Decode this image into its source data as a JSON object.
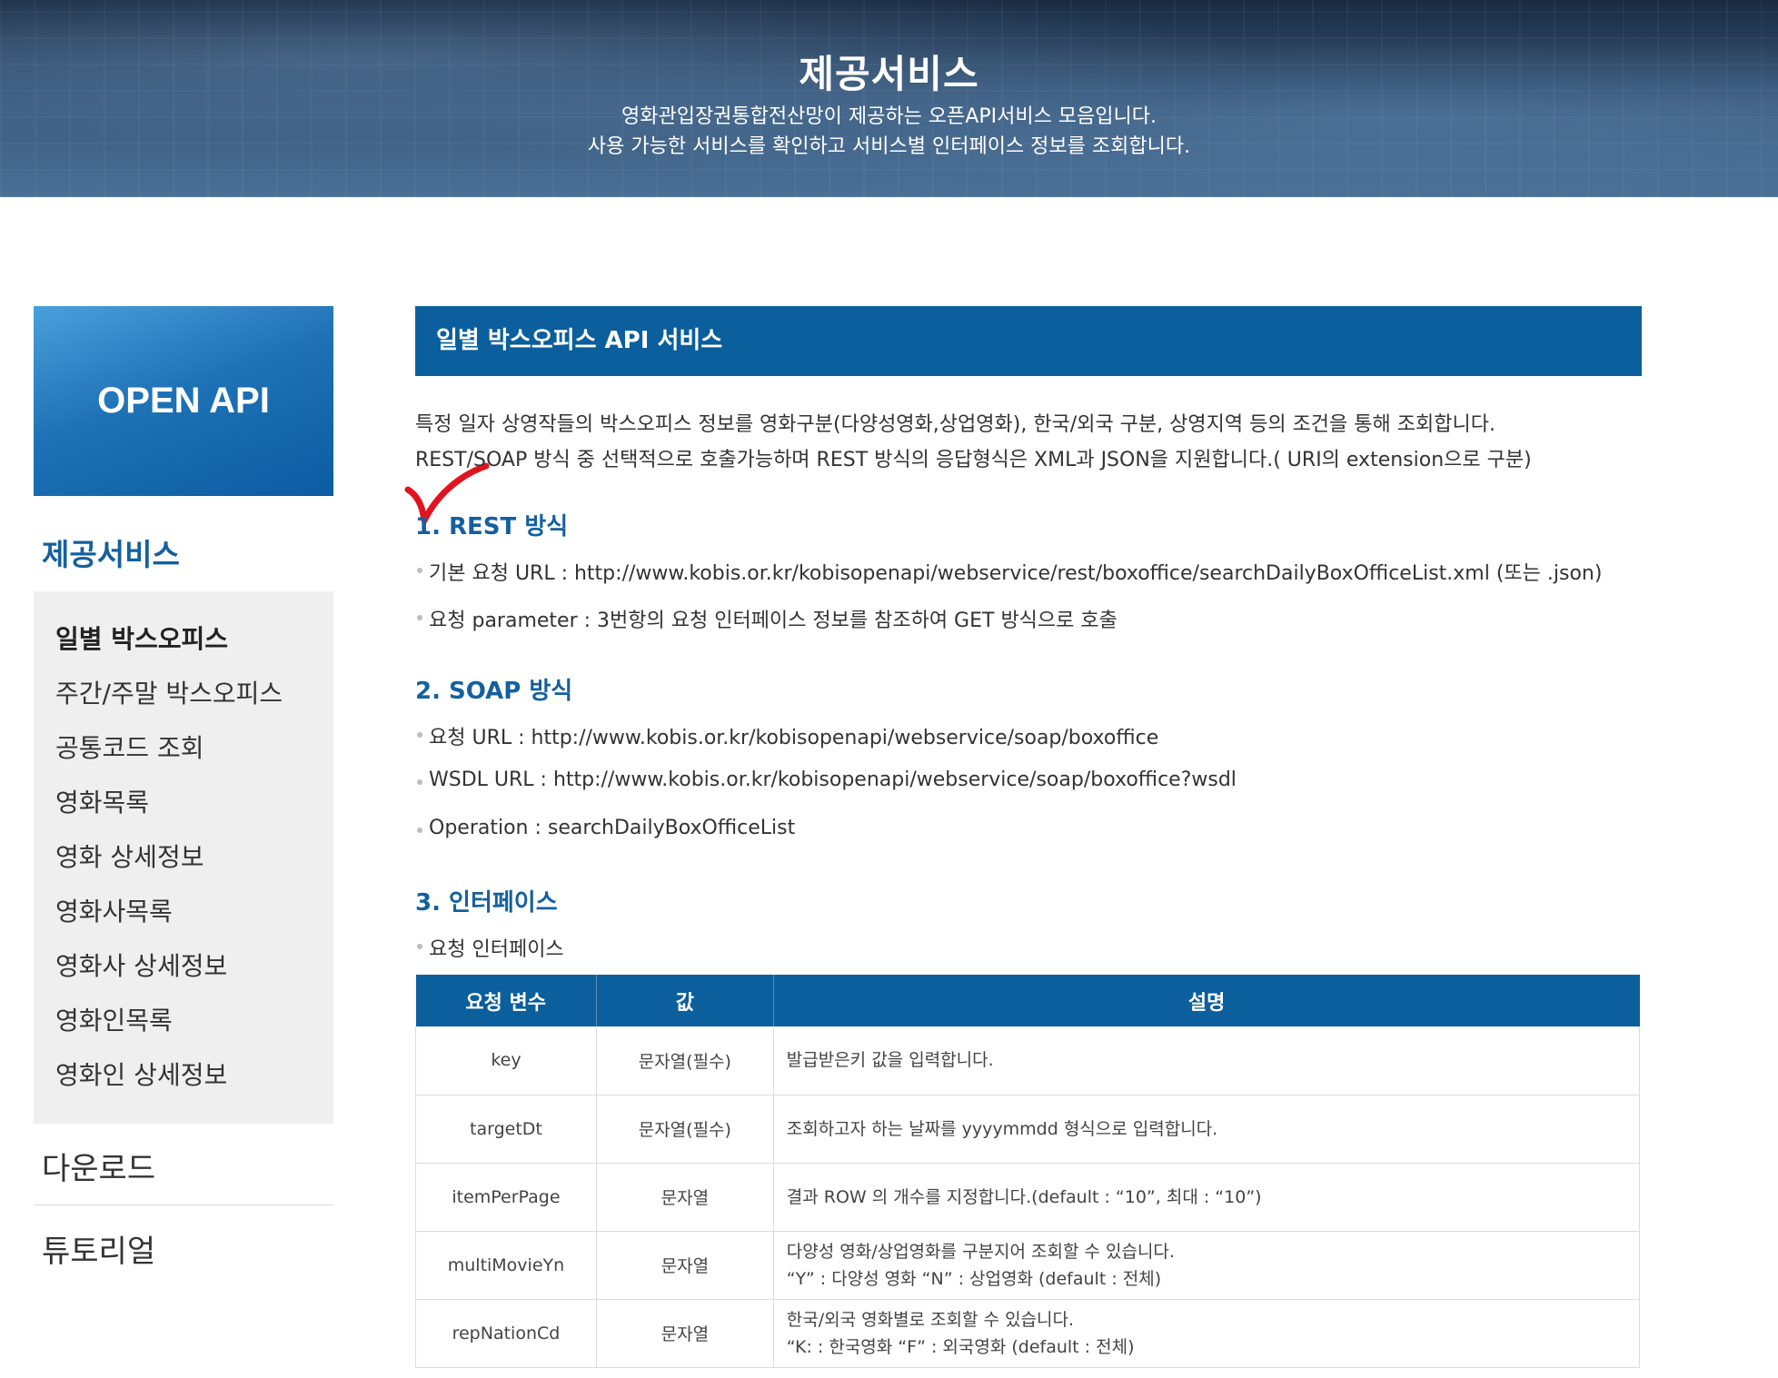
{
  "banner": {
    "title": "제공서비스",
    "line1": "영화관입장권통합전산망이 제공하는 오픈API서비스 모음입니다.",
    "line2": "사용 가능한 서비스를 확인하고 서비스별 인터페이스 정보를 조회합니다."
  },
  "sidebar": {
    "open_api": "OPEN API",
    "section_title": "제공서비스",
    "items": [
      {
        "label": "일별 박스오피스"
      },
      {
        "label": "주간/주말 박스오피스"
      },
      {
        "label": "공통코드 조회"
      },
      {
        "label": "영화목록"
      },
      {
        "label": "영화 상세정보"
      },
      {
        "label": "영화사목록"
      },
      {
        "label": "영화사 상세정보"
      },
      {
        "label": "영화인목록"
      },
      {
        "label": "영화인 상세정보"
      }
    ],
    "download": "다운로드",
    "tutorial": "튜토리얼"
  },
  "main": {
    "title": "일별 박스오피스 API 서비스",
    "intro1": "특정 일자 상영작들의 박스오피스 정보를 영화구분(다양성영화,상업영화), 한국/외국 구분, 상영지역 등의 조건을 통해 조회합니다.",
    "intro2": "REST/SOAP 방식 중 선택적으로 호출가능하며 REST 방식의 응답형식은 XML과 JSON을 지원합니다.( URI의 extension으로 구분)",
    "rest": {
      "title": "1. REST 방식",
      "bullets": [
        "기본 요청 URL : http://www.kobis.or.kr/kobisopenapi/webservice/rest/boxoffice/searchDailyBoxOfficeList.xml (또는 .json)",
        "요청 parameter : 3번항의 요청 인터페이스 정보를 참조하여 GET 방식으로 호출"
      ]
    },
    "soap": {
      "title": "2. SOAP 방식",
      "bullets": [
        "요청 URL : http://www.kobis.or.kr/kobisopenapi/webservice/soap/boxoffice",
        "WSDL URL : http://www.kobis.or.kr/kobisopenapi/webservice/soap/boxoffice?wsdl",
        "Operation : searchDailyBoxOfficeList"
      ]
    },
    "iface": {
      "title": "3. 인터페이스",
      "bullet": "요청 인터페이스",
      "headers": [
        "요청 변수",
        "값",
        "설명"
      ],
      "rows": [
        {
          "name": "key",
          "value": "문자열(필수)",
          "desc1": "발급받은키 값을 입력합니다.",
          "desc2": ""
        },
        {
          "name": "targetDt",
          "value": "문자열(필수)",
          "desc1": "조회하고자 하는 날짜를 yyyymmdd 형식으로 입력합니다.",
          "desc2": ""
        },
        {
          "name": "itemPerPage",
          "value": "문자열",
          "desc1": "결과 ROW 의 개수를 지정합니다.(default : “10”, 최대 : “10”)",
          "desc2": ""
        },
        {
          "name": "multiMovieYn",
          "value": "문자열",
          "desc1": "다양성 영화/상업영화를 구분지어 조회할 수 있습니다.",
          "desc2": "“Y” : 다양성 영화 “N” : 상업영화 (default : 전체)"
        },
        {
          "name": "repNationCd",
          "value": "문자열",
          "desc1": "한국/외국 영화별로 조회할 수 있습니다.",
          "desc2": "“K: : 한국영화 “F” : 외국영화 (default : 전체)"
        }
      ]
    }
  },
  "colors": {
    "primary": "#0b5f9c",
    "section_text": "#14609f",
    "check_mark": "#e0141e"
  }
}
